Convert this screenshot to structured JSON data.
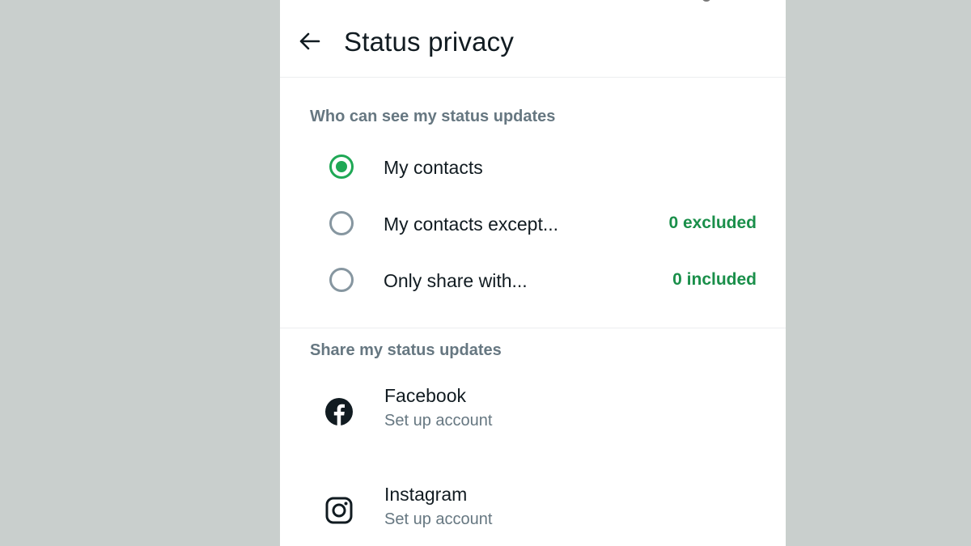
{
  "appbar": {
    "title": "Status privacy",
    "back_icon": "arrow-left-icon"
  },
  "audience": {
    "section_label": "Who can see my status updates",
    "options": [
      {
        "label": "My contacts",
        "meta": "",
        "selected": true
      },
      {
        "label": "My contacts except...",
        "meta": "0 excluded",
        "selected": false
      },
      {
        "label": "Only share with...",
        "meta": "0 included",
        "selected": false
      }
    ]
  },
  "share": {
    "section_label": "Share my status updates",
    "accounts": [
      {
        "name": "Facebook",
        "subtitle": "Set up account",
        "icon": "facebook-icon"
      },
      {
        "name": "Instagram",
        "subtitle": "Set up account",
        "icon": "instagram-icon"
      }
    ]
  },
  "colors": {
    "accent": "#1fa855",
    "meta_green": "#1a8f4a",
    "radio_off": "#8696a0",
    "page_bg": "#c9cfcd"
  }
}
